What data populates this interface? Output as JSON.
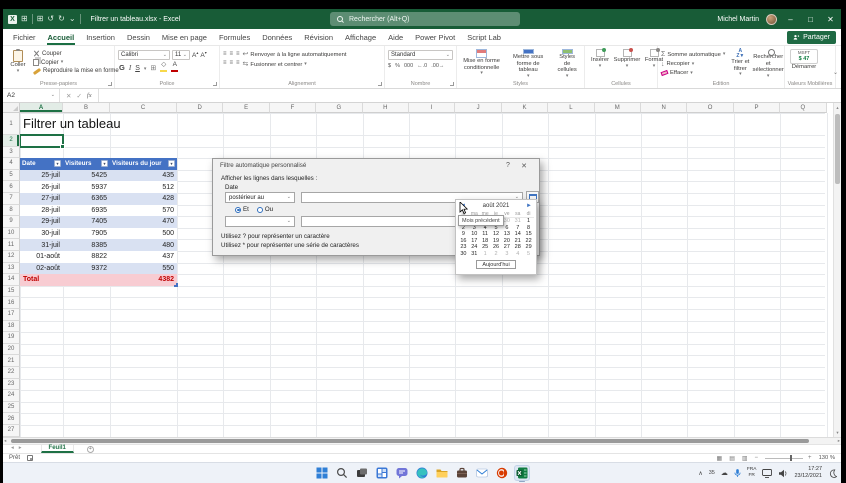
{
  "titlebar": {
    "filename": "Filtrer un tableau.xlsx - Excel",
    "search": "Rechercher (Alt+Q)",
    "user": "Michel Martin"
  },
  "menubar": {
    "tabs": [
      "Fichier",
      "Accueil",
      "Insertion",
      "Dessin",
      "Mise en page",
      "Formules",
      "Données",
      "Révision",
      "Affichage",
      "Aide",
      "Power Pivot",
      "Script Lab"
    ],
    "active_tab": "Accueil",
    "share": "Partager"
  },
  "ribbon": {
    "paste": "Coller",
    "cut": "Couper",
    "copy": "Copier",
    "format_painter": "Reproduire la mise en forme",
    "clipboard_group": "Presse-papiers",
    "font_name": "Calibri",
    "font_size": "11",
    "bold": "G",
    "italic": "I",
    "underline": "S",
    "font_group": "Police",
    "wrap_text": "Renvoyer à la ligne automatiquement",
    "merge_center": "Fusionner et centrer",
    "alignment_group": "Alignement",
    "number_format": "Standard",
    "number_group": "Nombre",
    "conditional": "Mise en forme conditionnelle",
    "format_table": "Mettre sous forme de tableau",
    "cell_styles": "Styles de cellules",
    "styles_group": "Styles",
    "insert": "Insérer",
    "delete": "Supprimer",
    "format": "Format",
    "cells_group": "Cellules",
    "autosum": "Somme automatique",
    "fill": "Recopier",
    "clear": "Effacer",
    "sort_filter": "Trier et filtrer",
    "find_select": "Rechercher et sélectionner",
    "editing_group": "Édition",
    "stock_ticker": "MSFT",
    "stock_price": "$ 47",
    "stocks_start": "Démarrer",
    "stocks_group": "Valeurs Mobilières"
  },
  "formula_bar": {
    "name_box": "A2",
    "fx": "fx",
    "value": ""
  },
  "grid": {
    "columns": [
      "A",
      "B",
      "C",
      "D",
      "E",
      "F",
      "G",
      "H",
      "I",
      "J",
      "K",
      "L",
      "M",
      "N",
      "O",
      "P",
      "Q"
    ],
    "row_count": 28,
    "a1_title": "Filtrer un tableau",
    "selected_cell": "A2"
  },
  "table": {
    "headers": [
      "Date",
      "Visiteurs",
      "Visiteurs du jour"
    ],
    "rows": [
      [
        "25-juil",
        "5425",
        "435"
      ],
      [
        "26-juil",
        "5937",
        "512"
      ],
      [
        "27-juil",
        "6365",
        "428"
      ],
      [
        "28-juil",
        "6935",
        "570"
      ],
      [
        "29-juil",
        "7405",
        "470"
      ],
      [
        "30-juil",
        "7905",
        "500"
      ],
      [
        "31-juil",
        "8385",
        "480"
      ],
      [
        "01-août",
        "8822",
        "437"
      ],
      [
        "02-août",
        "9372",
        "550"
      ]
    ],
    "total_label": "Total",
    "total_value": "4382"
  },
  "dialog": {
    "title": "Filtre automatique personnalisé",
    "header": "Afficher les lignes dans lesquelles :",
    "field_label": "Date",
    "operator": "postérieur au",
    "radio_and": "Et",
    "radio_or": "Ou",
    "hint_line1": "Utilisez ? pour représenter un caractère",
    "hint_line2": "Utilisez * pour représenter une série de caractères"
  },
  "calendar": {
    "month_label": "août 2021",
    "prev_tooltip": "Mois précédent",
    "day_names": [
      "lu",
      "ma",
      "me",
      "je",
      "ve",
      "sa",
      "di"
    ],
    "weeks": [
      [
        {
          "d": "26",
          "o": 1
        },
        {
          "d": "27",
          "o": 1
        },
        {
          "d": "28",
          "o": 1
        },
        {
          "d": "29",
          "o": 1
        },
        {
          "d": "30",
          "o": 1
        },
        {
          "d": "31",
          "o": 1
        },
        {
          "d": "1",
          "o": 0
        }
      ],
      [
        {
          "d": "2",
          "o": 0
        },
        {
          "d": "3",
          "o": 0
        },
        {
          "d": "4",
          "o": 0
        },
        {
          "d": "5",
          "o": 0
        },
        {
          "d": "6",
          "o": 0
        },
        {
          "d": "7",
          "o": 0
        },
        {
          "d": "8",
          "o": 0
        }
      ],
      [
        {
          "d": "9",
          "o": 0
        },
        {
          "d": "10",
          "o": 0
        },
        {
          "d": "11",
          "o": 0
        },
        {
          "d": "12",
          "o": 0
        },
        {
          "d": "13",
          "o": 0
        },
        {
          "d": "14",
          "o": 0
        },
        {
          "d": "15",
          "o": 0
        }
      ],
      [
        {
          "d": "16",
          "o": 0
        },
        {
          "d": "17",
          "o": 0
        },
        {
          "d": "18",
          "o": 0
        },
        {
          "d": "19",
          "o": 0
        },
        {
          "d": "20",
          "o": 0
        },
        {
          "d": "21",
          "o": 0
        },
        {
          "d": "22",
          "o": 0
        }
      ],
      [
        {
          "d": "23",
          "o": 0
        },
        {
          "d": "24",
          "o": 0
        },
        {
          "d": "25",
          "o": 0
        },
        {
          "d": "26",
          "o": 0
        },
        {
          "d": "27",
          "o": 0
        },
        {
          "d": "28",
          "o": 0
        },
        {
          "d": "29",
          "o": 0
        }
      ],
      [
        {
          "d": "30",
          "o": 0
        },
        {
          "d": "31",
          "o": 0
        },
        {
          "d": "1",
          "o": 1
        },
        {
          "d": "2",
          "o": 1
        },
        {
          "d": "3",
          "o": 1
        },
        {
          "d": "4",
          "o": 1
        },
        {
          "d": "5",
          "o": 1
        }
      ]
    ],
    "today_button": "Aujourd'hui"
  },
  "sheet_bar": {
    "tab": "Feuil1"
  },
  "status_bar": {
    "mode": "Prêt",
    "zoom": "130 %"
  },
  "taskbar": {
    "tray_percent": "35",
    "lang_line1": "FRA",
    "lang_line2": "FR",
    "time": "17:27",
    "date": "23/12/2021"
  },
  "glyphs": {
    "dd": "▾",
    "ddsm": "⌄",
    "up": "▴",
    "undo": "↺",
    "redo": "↻",
    "min": "–",
    "max": "□",
    "close": "✕",
    "help": "?",
    "cancel": "✕",
    "check": "✓",
    "eq": "≡",
    "wrap": "↩",
    "merge": "⇆",
    "borders": "⊞",
    "dollar": "$",
    "pct": "%",
    "zeros": "000",
    "decl": "←.0",
    "decr": ".00→",
    "sigma": "Σ",
    "fdown": "↓",
    "navl": "◂",
    "navr": "▸",
    "plus": "+",
    "left": "◄",
    "right": "►",
    "viewa": "▦",
    "viewb": "▤",
    "viewc": "▥",
    "minus": "−",
    "caret": "∧",
    "cloud": "☁",
    "az": "AZ",
    "funnel": "▼",
    "grid": "⊞",
    "A": "A"
  }
}
